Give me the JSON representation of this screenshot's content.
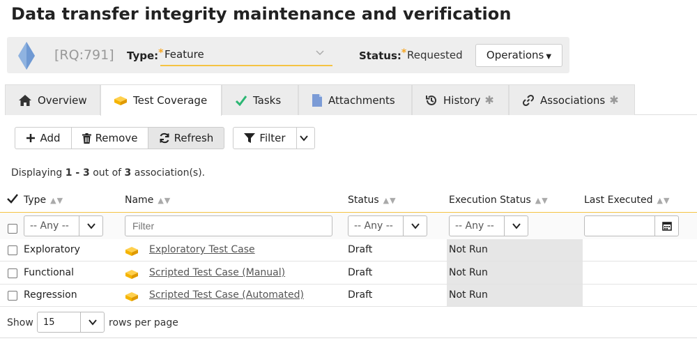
{
  "page_title": "Data transfer integrity maintenance and verification",
  "header": {
    "id": "[RQ:791]",
    "type_label": "Type:",
    "type_value": "Feature",
    "status_label": "Status:",
    "status_value": "Requested",
    "operations_label": "Operations",
    "required_mark": "*"
  },
  "tabs": [
    {
      "label": "Overview",
      "icon": "home-icon"
    },
    {
      "label": "Test Coverage",
      "icon": "test-case-icon"
    },
    {
      "label": "Tasks",
      "icon": "check-icon"
    },
    {
      "label": "Attachments",
      "icon": "document-icon"
    },
    {
      "label": "History",
      "icon": "history-icon"
    },
    {
      "label": "Associations",
      "icon": "link-icon"
    }
  ],
  "tab_star": "✱",
  "toolbar": {
    "add": "Add",
    "remove": "Remove",
    "refresh": "Refresh",
    "filter": "Filter"
  },
  "display": {
    "prefix": "Displaying ",
    "range": "1 - 3",
    "middle": " out of ",
    "total": "3",
    "suffix": " association(s)."
  },
  "columns": {
    "type": "Type",
    "name": "Name",
    "status": "Status",
    "execution_status": "Execution Status",
    "last_executed": "Last Executed"
  },
  "filters": {
    "type_any": "-- Any --",
    "name_placeholder": "Filter",
    "status_any": "-- Any --",
    "exec_any": "-- Any --"
  },
  "rows": [
    {
      "type": "Exploratory",
      "name": "Exploratory Test Case",
      "status": "Draft",
      "execution_status": "Not Run",
      "last_executed": ""
    },
    {
      "type": "Functional",
      "name": "Scripted Test Case (Manual)",
      "status": "Draft",
      "execution_status": "Not Run",
      "last_executed": ""
    },
    {
      "type": "Regression",
      "name": "Scripted Test Case (Automated)",
      "status": "Draft",
      "execution_status": "Not Run",
      "last_executed": ""
    }
  ],
  "footer": {
    "show_label": "Show",
    "rows_value": "15",
    "rows_suffix": "rows per page"
  },
  "colors": {
    "accent": "#f5c342",
    "required": "#f5a623",
    "requirement_diamond": "#8fb3e0",
    "test_case_icon": "#f5b400",
    "check_icon": "#2bb673",
    "document_icon": "#7b9bd6"
  }
}
